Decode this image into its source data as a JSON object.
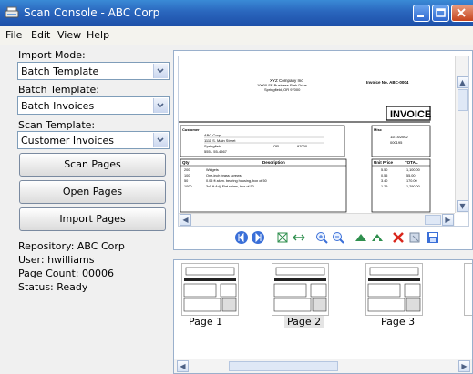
{
  "window": {
    "title": "Scan Console - ABC Corp"
  },
  "menu": [
    "File",
    "Edit",
    "View",
    "Help"
  ],
  "import_mode": {
    "label": "Import Mode:",
    "value": "Batch Template"
  },
  "batch_template": {
    "label": "Batch Template:",
    "value": "Batch Invoices"
  },
  "scan_template": {
    "label": "Scan Template:",
    "value": "Customer Invoices"
  },
  "buttons": {
    "scan": "Scan Pages",
    "open": "Open Pages",
    "import": "Import Pages"
  },
  "status": {
    "repository": "Repository: ABC Corp",
    "user": "User: hwilliams",
    "page_count": "Page Count: 00006",
    "state": "Status: Ready"
  },
  "document": {
    "company": "XYZ Company Inc",
    "address1": "10000 SE Business Park Drive",
    "address2": "Springfield, OR 97000",
    "invoice_no": "Invoice No. ABC-0004",
    "heading": "INVOICE",
    "customer_label": "Customer",
    "customer_name": "ABC Corp",
    "customer_street": "1111 S. Main Street",
    "customer_city": "Springfield",
    "customer_state": "OR",
    "customer_zip": "97000",
    "customer_phone": "555 - 55-4567",
    "misc_label": "Misc",
    "date": "11/14/2002",
    "order_no": "000195",
    "col_qty": "Qty",
    "col_desc": "Description",
    "col_price": "Unit Price",
    "col_total": "TOTAL",
    "rows": [
      {
        "qty": "200",
        "desc": "Widgets",
        "price": "5.50",
        "total": "1,100.00"
      },
      {
        "qty": "100",
        "desc": "One-inch brass screws",
        "price": "0.55",
        "total": "55.00"
      },
      {
        "qty": "50",
        "desc": "0.05 ft alum. bearing housing, box of 50",
        "price": "3.40",
        "total": "170.00"
      },
      {
        "qty": "1000",
        "desc": "3x5 ft Adj. Flat shims, box of 50",
        "price": "1.29",
        "total": "1,290.00"
      }
    ]
  },
  "thumbnails": [
    {
      "label": "Page 1"
    },
    {
      "label": "Page 2"
    },
    {
      "label": "Page 3"
    }
  ],
  "toolbar_icons": [
    "first-page-icon",
    "next-page-icon",
    "fit-page-icon",
    "fit-width-icon",
    "zoom-in-icon",
    "zoom-out-icon",
    "rotate-left-icon",
    "rotate-right-icon",
    "delete-icon",
    "select-icon",
    "save-icon"
  ],
  "colors": {
    "titlebar": "#2a66bd",
    "accent": "#3a6fd8",
    "delete": "#d9261c"
  }
}
